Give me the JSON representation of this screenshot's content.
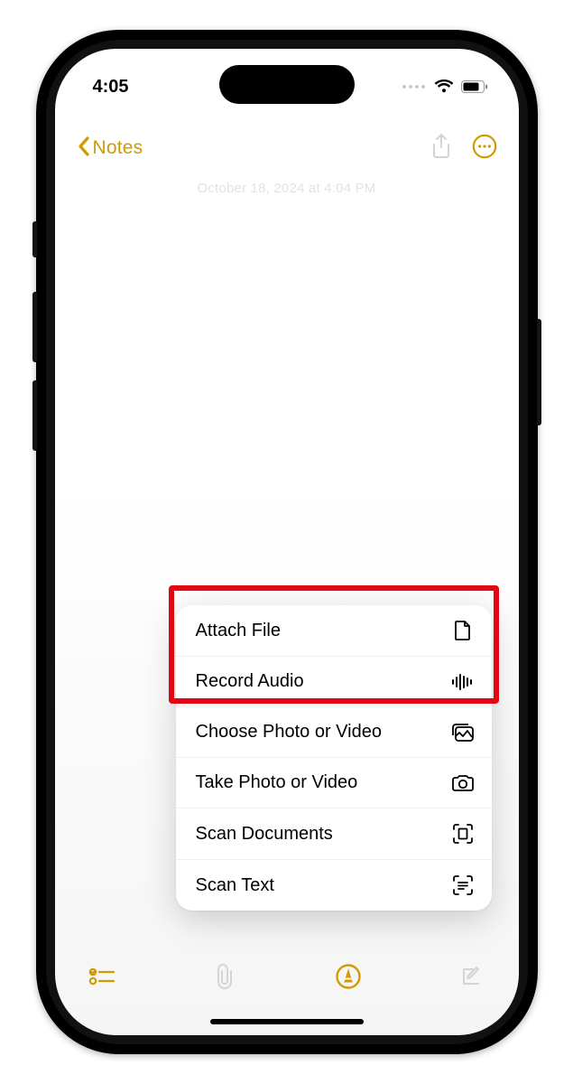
{
  "colors": {
    "accent": "#d19a00",
    "highlight": "#e30613"
  },
  "status": {
    "time": "4:05"
  },
  "nav": {
    "back_label": "Notes"
  },
  "note": {
    "meta_line": "October 18, 2024 at 4:04 PM"
  },
  "menu": {
    "items": [
      {
        "label": "Attach File",
        "icon": "document-icon"
      },
      {
        "label": "Record Audio",
        "icon": "waveform-icon"
      },
      {
        "label": "Choose Photo or Video",
        "icon": "photo-stack-icon"
      },
      {
        "label": "Take Photo or Video",
        "icon": "camera-icon"
      },
      {
        "label": "Scan Documents",
        "icon": "scan-doc-icon"
      },
      {
        "label": "Scan Text",
        "icon": "scan-text-icon"
      }
    ]
  },
  "toolbar": {
    "items": [
      {
        "name": "checklist-button",
        "icon": "checklist-icon"
      },
      {
        "name": "attach-button",
        "icon": "paperclip-icon"
      },
      {
        "name": "markup-button",
        "icon": "markup-icon"
      },
      {
        "name": "compose-button",
        "icon": "compose-icon"
      }
    ]
  },
  "annotation": {
    "highlighted_items": [
      "Attach File",
      "Record Audio"
    ]
  }
}
